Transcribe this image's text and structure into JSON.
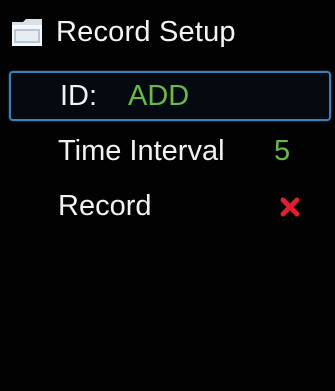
{
  "header": {
    "title": "Record Setup",
    "icon": "folder-icon"
  },
  "menu": {
    "items": [
      {
        "label": "ID:",
        "value": "ADD",
        "selected": true
      },
      {
        "label": "Time Interval",
        "value": "5",
        "selected": false
      },
      {
        "label": "Record",
        "value_icon": "close-icon",
        "selected": false
      }
    ]
  },
  "colors": {
    "value_green": "#6ab84b",
    "selection_border": "#3f7fb8",
    "status_red": "#e21d2f",
    "text": "#f2f2f2",
    "background": "#020202"
  }
}
